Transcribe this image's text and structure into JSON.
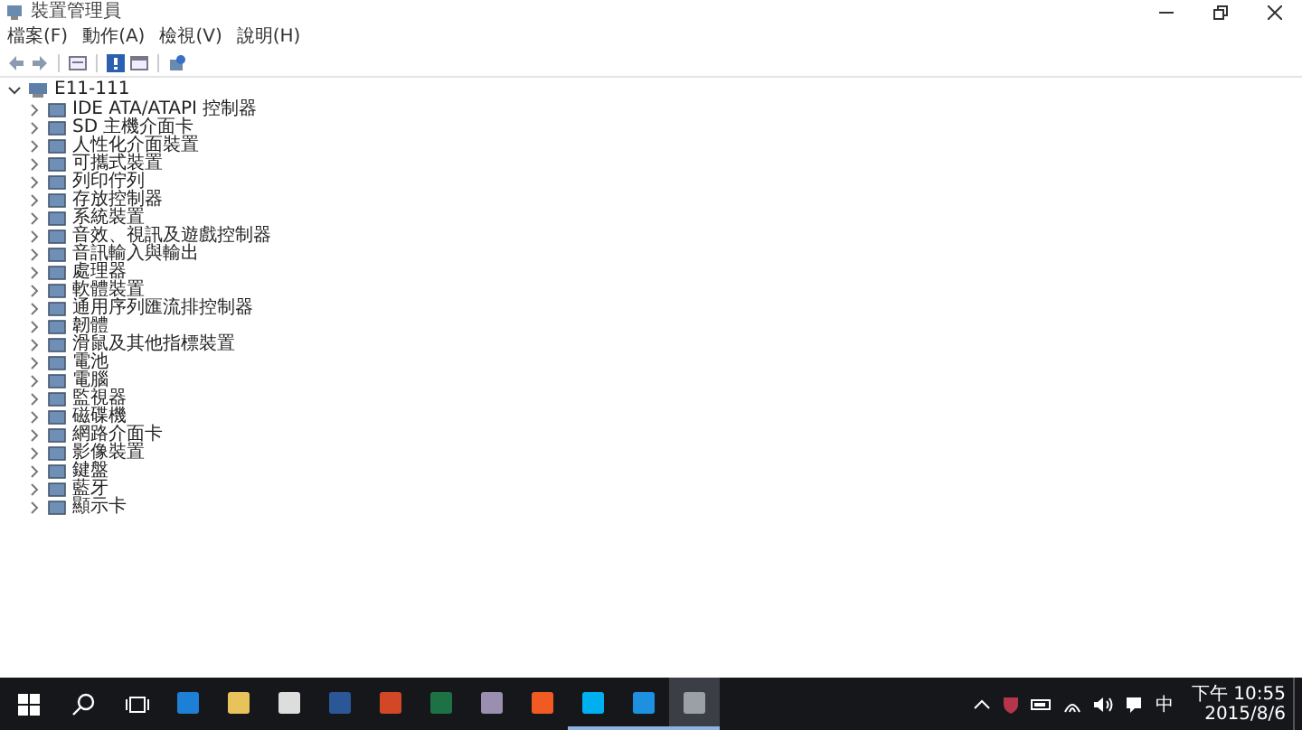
{
  "window": {
    "title": "裝置管理員"
  },
  "menu": [
    "檔案(F)",
    "動作(A)",
    "檢視(V)",
    "說明(H)"
  ],
  "tree": {
    "label": "E11-111",
    "expanded": true,
    "children": [
      {
        "label": "IDE ATA/ATAPI 控制器",
        "expanded": false
      },
      {
        "label": "SD 主機介面卡",
        "expanded": false
      },
      {
        "label": "人性化介面裝置",
        "expanded": false
      },
      {
        "label": "可攜式裝置",
        "expanded": false
      },
      {
        "label": "列印佇列",
        "expanded": false
      },
      {
        "label": "存放控制器",
        "expanded": false
      },
      {
        "label": "系統裝置",
        "expanded": false
      },
      {
        "label": "音效、視訊及遊戲控制器",
        "expanded": false
      },
      {
        "label": "音訊輸入與輸出",
        "expanded": false
      },
      {
        "label": "處理器",
        "expanded": false
      },
      {
        "label": "軟體裝置",
        "expanded": false
      },
      {
        "label": "通用序列匯流排控制器",
        "expanded": false
      },
      {
        "label": "韌體",
        "expanded": false
      },
      {
        "label": "滑鼠及其他指標裝置",
        "expanded": false
      },
      {
        "label": "電池",
        "expanded": false
      },
      {
        "label": "電腦",
        "expanded": false
      },
      {
        "label": "監視器",
        "expanded": false
      },
      {
        "label": "磁碟機",
        "expanded": false
      },
      {
        "label": "網路介面卡",
        "expanded": false
      },
      {
        "label": "影像裝置",
        "expanded": false
      },
      {
        "label": "鍵盤",
        "expanded": false
      },
      {
        "label": "藍牙",
        "expanded": false
      },
      {
        "label": "顯示卡",
        "expanded": false
      }
    ]
  },
  "taskbar": {
    "apps": [
      {
        "kind": "edge",
        "running": false,
        "selected": false
      },
      {
        "kind": "folder",
        "running": false,
        "selected": false
      },
      {
        "kind": "store",
        "running": false,
        "selected": false
      },
      {
        "kind": "word",
        "running": false,
        "selected": false
      },
      {
        "kind": "powerpoint",
        "running": false,
        "selected": false
      },
      {
        "kind": "excel",
        "running": false,
        "selected": false
      },
      {
        "kind": "paint",
        "running": false,
        "selected": false
      },
      {
        "kind": "mi",
        "running": false,
        "selected": false
      },
      {
        "kind": "skype",
        "running": true,
        "selected": false
      },
      {
        "kind": "settings",
        "running": true,
        "selected": false
      },
      {
        "kind": "devmgr",
        "running": true,
        "selected": true
      }
    ],
    "ime": "中",
    "time": "下午 10:55",
    "date": "2015/8/6"
  }
}
